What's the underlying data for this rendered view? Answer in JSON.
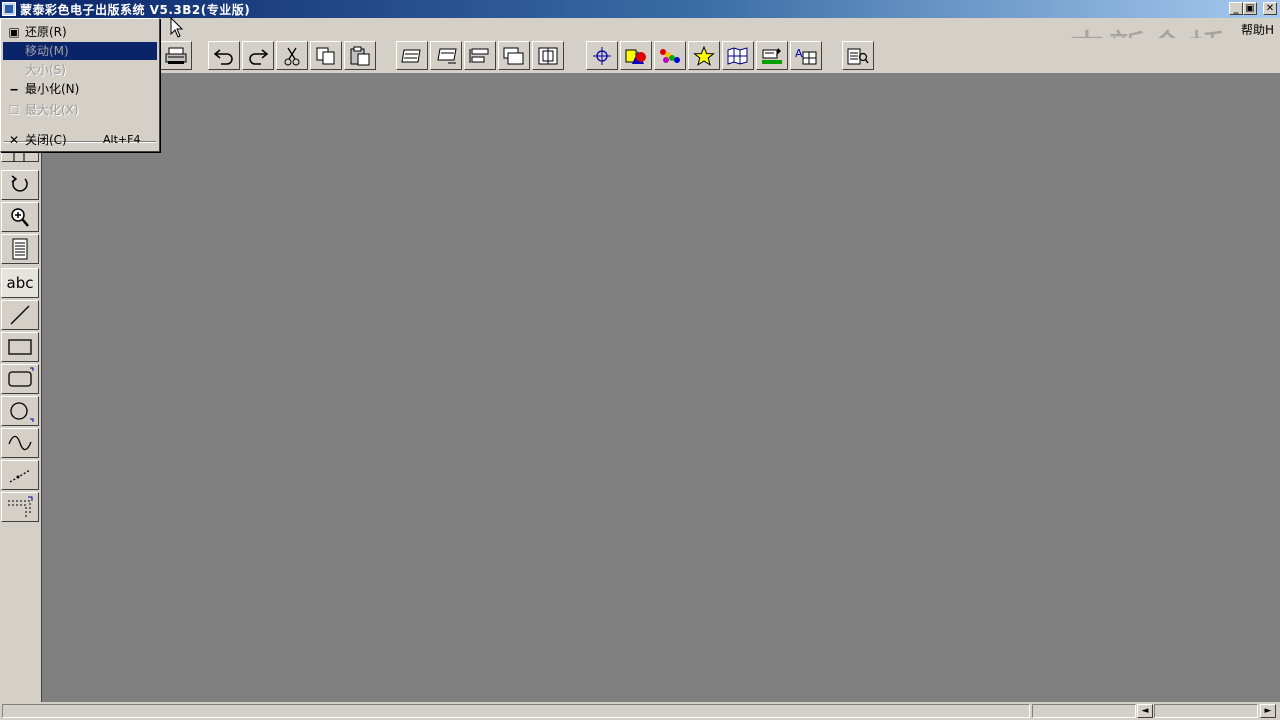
{
  "window": {
    "title": "蒙泰彩色电子出版系统 V5.3B2(专业版)",
    "controls": {
      "minimize": "_",
      "restore": "▣",
      "close": "✕"
    }
  },
  "menubar": {
    "help": "帮助H"
  },
  "watermark": "中新金桥",
  "system_menu": {
    "items": [
      {
        "icon": "restore-icon",
        "label": "还原(R)",
        "shortcut": "",
        "disabled": false,
        "selected": false
      },
      {
        "icon": "",
        "label": "移动(M)",
        "shortcut": "",
        "disabled": true,
        "selected": true
      },
      {
        "icon": "",
        "label": "大小(S)",
        "shortcut": "",
        "disabled": true,
        "selected": false
      },
      {
        "icon": "minimize-icon",
        "label": "最小化(N)",
        "shortcut": "",
        "disabled": false,
        "selected": false
      },
      {
        "icon": "maximize-icon",
        "label": "最大化(X)",
        "shortcut": "",
        "disabled": true,
        "selected": false
      },
      {
        "icon": "close-icon",
        "label": "关闭(C)",
        "shortcut": "Alt+F4",
        "disabled": false,
        "selected": false
      }
    ]
  },
  "toolbar": {
    "groups": [
      [
        "print-icon"
      ],
      [
        "undo-icon",
        "redo-icon",
        "cut-icon",
        "copy-icon",
        "paste-icon"
      ],
      [
        "bring-forward-icon",
        "send-backward-icon",
        "align-icon",
        "layers-icon",
        "group-icon"
      ],
      [
        "move-crosshair-icon",
        "shapes-color-icon",
        "color-palette-icon",
        "star-icon",
        "map-icon",
        "fill-icon",
        "text-grid-icon"
      ],
      [
        "preview-icon"
      ]
    ]
  },
  "left_tools": {
    "items": [
      "text-cursor-icon",
      "rotate-icon",
      "zoom-icon",
      "page-icon",
      "abc-text-icon",
      "line-icon",
      "rectangle-icon",
      "rounded-rect-icon",
      "ellipse-icon",
      "curve-icon",
      "dashed-line-icon",
      "table-frame-icon"
    ],
    "abc_label": "abc"
  },
  "colors": {
    "workspace": "#808080",
    "chrome": "#d4d0c8",
    "title_start": "#0a246a",
    "title_end": "#a6caf0",
    "menu_highlight": "#0a246a"
  }
}
